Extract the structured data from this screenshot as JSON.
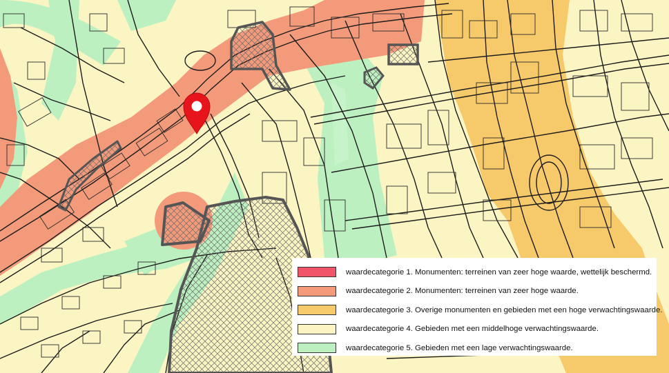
{
  "map": {
    "colors": {
      "base": "#fbf5c3",
      "cat2": "#f39a7b",
      "cat3": "#f6c96b",
      "cat5": "#bdf0c0",
      "street": "#1c1c1c",
      "building": "#2a2a2a",
      "protected": "#555555",
      "marker": "#e8141b"
    },
    "marker_icon": "location-pin-icon"
  },
  "legend": {
    "items": [
      {
        "label": "waardecategorie 1. Monumenten: terreinen van zeer hoge waarde, wettelijk beschermd.",
        "color": "#f0556a"
      },
      {
        "label": "waardecategorie 2. Monumenten: terreinen van zeer hoge waarde.",
        "color": "#f39a7b"
      },
      {
        "label": "waardecategorie 3. Overige monumenten en gebieden met een hoge verwachtingswaarde.",
        "color": "#f6c96b"
      },
      {
        "label": "waardecategorie 4. Gebieden met een middelhoge verwachtingswaarde.",
        "color": "#fbf5c3"
      },
      {
        "label": "waardecategorie 5. Gebieden met een lage verwachtingswaarde.",
        "color": "#bdf0c0"
      }
    ]
  }
}
